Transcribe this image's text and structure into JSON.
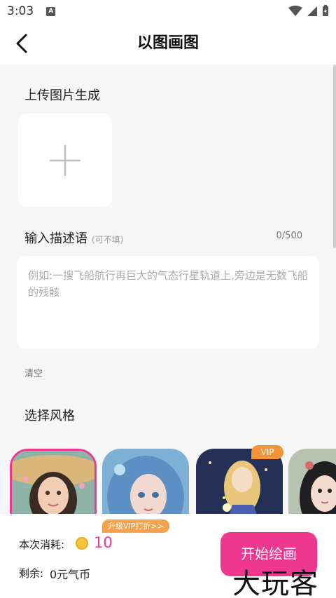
{
  "status_bar": {
    "time": "3:03",
    "notification_badge": "A"
  },
  "header": {
    "title": "以图画图"
  },
  "upload": {
    "label": "上传图片生成"
  },
  "description": {
    "label": "输入描述语",
    "hint": "(可不填)",
    "counter": "0/500",
    "placeholder": "例如:一搜飞船航行再巨大的气态行星轨道上,旁边是无数飞船的残骸",
    "clear_label": "清空"
  },
  "styles": {
    "label": "选择风格",
    "vip_badge": "VIP",
    "items": [
      {
        "name": "style-1",
        "selected": true
      },
      {
        "name": "style-2",
        "selected": false
      },
      {
        "name": "style-3",
        "selected": false,
        "vip": true
      },
      {
        "name": "style-4",
        "selected": false
      }
    ]
  },
  "footer": {
    "vip_promo": "升级VIP打折>>",
    "cost_label": "本次消耗:",
    "cost_value": "10",
    "balance_label": "剩余:",
    "balance_value": "0元气币",
    "start_button": "开始绘画"
  },
  "watermark": "大玩客",
  "colors": {
    "accent": "#f0378f",
    "vip": "#f39236"
  }
}
